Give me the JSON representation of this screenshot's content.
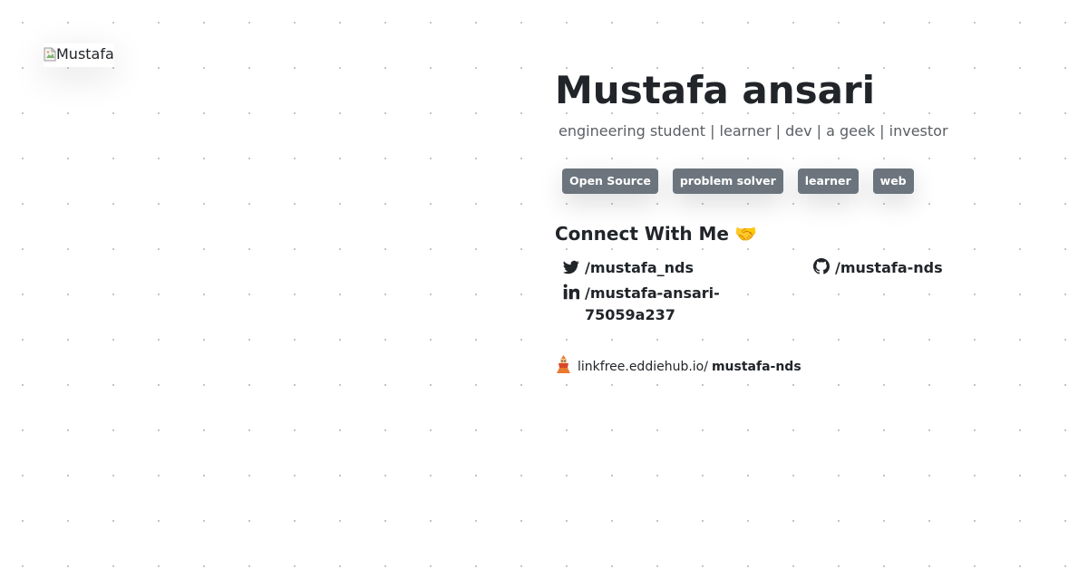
{
  "avatar": {
    "alt": "Mustafa"
  },
  "profile": {
    "name": "Mustafa ansari",
    "tagline": "engineering student | learner | dev | a geek | investor",
    "tags": [
      "Open Source",
      "problem solver",
      "learner",
      "web"
    ]
  },
  "connect": {
    "title": "Connect With Me",
    "title_emoji": "🤝",
    "twitter": "/mustafa_nds",
    "github": "/mustafa-nds",
    "linkedin": "/mustafa-ansari-75059a237"
  },
  "linkfree": {
    "domain": "linkfree.eddiehub.io/",
    "username": "mustafa-nds"
  },
  "icons": {
    "twitter": "twitter-icon",
    "github": "github-icon",
    "linkedin": "linkedin-icon",
    "linkfree": "linkfree-logo-icon",
    "broken": "broken-image-icon"
  },
  "colors": {
    "tag_bg": "#6c757d",
    "text": "#212529",
    "muted": "#5a5f64"
  }
}
